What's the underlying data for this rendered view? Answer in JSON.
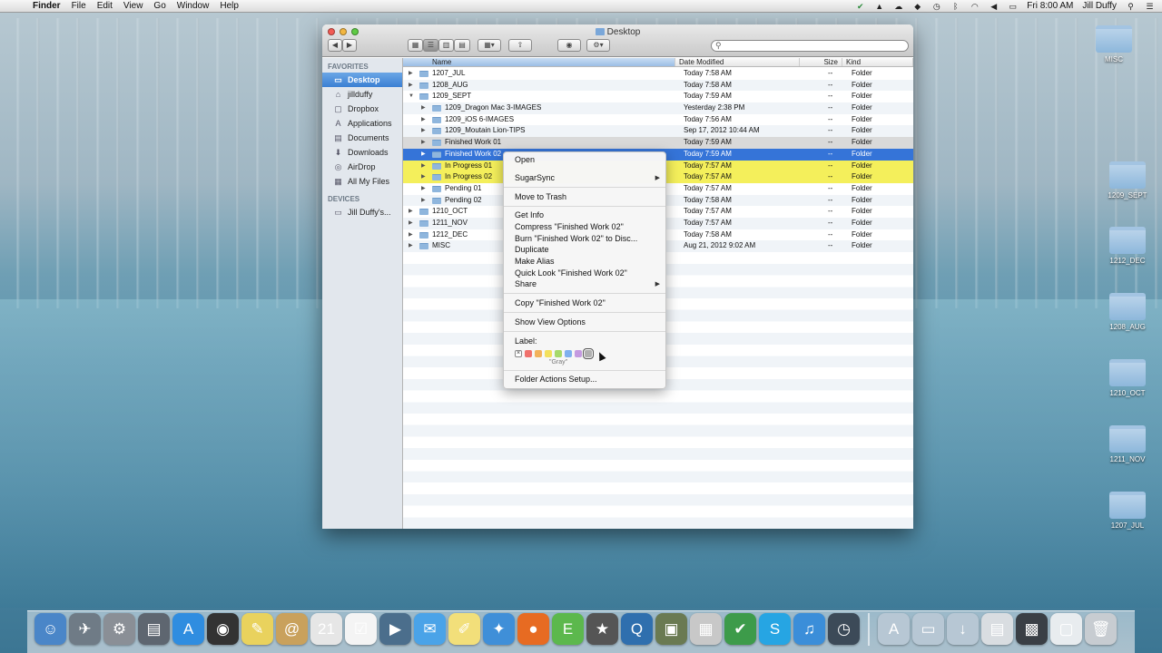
{
  "menubar": {
    "app_name": "Finder",
    "menus": [
      "File",
      "Edit",
      "View",
      "Go",
      "Window",
      "Help"
    ],
    "time": "Fri 8:00 AM",
    "user": "Jill Duffy"
  },
  "window": {
    "title": "Desktop",
    "search_placeholder": ""
  },
  "sidebar": {
    "favorites_heading": "FAVORITES",
    "favorites": [
      {
        "label": "Desktop",
        "icon": "desktop-icon"
      },
      {
        "label": "jillduffy",
        "icon": "home-icon"
      },
      {
        "label": "Dropbox",
        "icon": "dropbox-icon"
      },
      {
        "label": "Applications",
        "icon": "applications-icon"
      },
      {
        "label": "Documents",
        "icon": "documents-icon"
      },
      {
        "label": "Downloads",
        "icon": "downloads-icon"
      },
      {
        "label": "AirDrop",
        "icon": "airdrop-icon"
      },
      {
        "label": "All My Files",
        "icon": "all-files-icon"
      }
    ],
    "devices_heading": "DEVICES",
    "devices": [
      {
        "label": "Jill Duffy's...",
        "icon": "computer-icon"
      }
    ]
  },
  "columns": {
    "name": "Name",
    "date": "Date Modified",
    "size": "Size",
    "kind": "Kind"
  },
  "rows": [
    {
      "name": "1207_JUL",
      "date": "Today 7:58 AM",
      "size": "--",
      "kind": "Folder"
    },
    {
      "name": "1208_AUG",
      "date": "Today 7:58 AM",
      "size": "--",
      "kind": "Folder"
    },
    {
      "name": "1209_SEPT",
      "date": "Today 7:59 AM",
      "size": "--",
      "kind": "Folder"
    },
    {
      "name": "1209_Dragon Mac 3-IMAGES",
      "date": "Yesterday 2:38 PM",
      "size": "--",
      "kind": "Folder"
    },
    {
      "name": "1209_iOS 6-IMAGES",
      "date": "Today 7:56 AM",
      "size": "--",
      "kind": "Folder"
    },
    {
      "name": "1209_Moutain Lion-TIPS",
      "date": "Sep 17, 2012 10:44 AM",
      "size": "--",
      "kind": "Folder"
    },
    {
      "name": "Finished Work 01",
      "date": "Today 7:59 AM",
      "size": "--",
      "kind": "Folder"
    },
    {
      "name": "Finished Work 02",
      "date": "Today 7:59 AM",
      "size": "--",
      "kind": "Folder"
    },
    {
      "name": "In Progress 01",
      "date": "Today 7:57 AM",
      "size": "--",
      "kind": "Folder"
    },
    {
      "name": "In Progress 02",
      "date": "Today 7:57 AM",
      "size": "--",
      "kind": "Folder"
    },
    {
      "name": "Pending 01",
      "date": "Today 7:57 AM",
      "size": "--",
      "kind": "Folder"
    },
    {
      "name": "Pending 02",
      "date": "Today 7:58 AM",
      "size": "--",
      "kind": "Folder"
    },
    {
      "name": "1210_OCT",
      "date": "Today 7:57 AM",
      "size": "--",
      "kind": "Folder"
    },
    {
      "name": "1211_NOV",
      "date": "Today 7:57 AM",
      "size": "--",
      "kind": "Folder"
    },
    {
      "name": "1212_DEC",
      "date": "Today 7:58 AM",
      "size": "--",
      "kind": "Folder"
    },
    {
      "name": "MISC",
      "date": "Aug 21, 2012 9:02 AM",
      "size": "--",
      "kind": "Folder"
    }
  ],
  "context_menu": {
    "open": "Open",
    "sugarsync": "SugarSync",
    "move_to_trash": "Move to Trash",
    "get_info": "Get Info",
    "compress": "Compress \"Finished Work 02\"",
    "burn": "Burn \"Finished Work 02\" to Disc...",
    "duplicate": "Duplicate",
    "make_alias": "Make Alias",
    "quick_look": "Quick Look \"Finished Work 02\"",
    "share": "Share",
    "copy": "Copy \"Finished Work 02\"",
    "show_view_options": "Show View Options",
    "label_heading": "Label:",
    "label_hover": "\"Gray\"",
    "label_colors": [
      "#f0716c",
      "#f2b25b",
      "#f3e05c",
      "#a6d96a",
      "#7fb0ee",
      "#c49ae0",
      "#b0b0b0"
    ],
    "folder_actions": "Folder Actions Setup..."
  },
  "desktop_icons": [
    "MISC",
    "1209_SEPT",
    "1212_DEC",
    "1208_AUG",
    "1210_OCT",
    "1211_NOV",
    "1207_JUL"
  ],
  "dock_apps": [
    {
      "name": "finder-icon",
      "glyph": "☺",
      "color": "#4a86c8"
    },
    {
      "name": "launchpad-icon",
      "glyph": "✈",
      "color": "#6f7b86"
    },
    {
      "name": "system-preferences-icon",
      "glyph": "⚙",
      "color": "#8a8f96"
    },
    {
      "name": "app-icon-1",
      "glyph": "▤",
      "color": "#5e6670"
    },
    {
      "name": "app-store-icon",
      "glyph": "A",
      "color": "#2f8de0"
    },
    {
      "name": "dashboard-icon",
      "glyph": "◉",
      "color": "#333"
    },
    {
      "name": "stickies-icon",
      "glyph": "✎",
      "color": "#e9d25d"
    },
    {
      "name": "mail-icon",
      "glyph": "@",
      "color": "#c9a15c"
    },
    {
      "name": "calendar-icon",
      "glyph": "21",
      "color": "#e6e6e6"
    },
    {
      "name": "reminders-icon",
      "glyph": "☑",
      "color": "#f4f4f4"
    },
    {
      "name": "facetime-icon",
      "glyph": "▶",
      "color": "#4b6e8c"
    },
    {
      "name": "messages-icon",
      "glyph": "✉",
      "color": "#4aa3e8"
    },
    {
      "name": "notes-icon",
      "glyph": "✐",
      "color": "#f2df7a"
    },
    {
      "name": "safari-icon",
      "glyph": "✦",
      "color": "#3f8fd8"
    },
    {
      "name": "firefox-icon",
      "glyph": "●",
      "color": "#e76b22"
    },
    {
      "name": "evernote-icon",
      "glyph": "E",
      "color": "#5cb84d"
    },
    {
      "name": "imovie-icon",
      "glyph": "★",
      "color": "#555"
    },
    {
      "name": "quicktime-icon",
      "glyph": "Q",
      "color": "#2f6fae"
    },
    {
      "name": "preview-icon",
      "glyph": "▣",
      "color": "#6a7a52"
    },
    {
      "name": "calculator-icon",
      "glyph": "▦",
      "color": "#c8c8c8"
    },
    {
      "name": "upwork-icon",
      "glyph": "✔",
      "color": "#3d9b4a"
    },
    {
      "name": "skype-icon",
      "glyph": "S",
      "color": "#26a5e3"
    },
    {
      "name": "itunes-icon",
      "glyph": "♫",
      "color": "#3b8ed9"
    },
    {
      "name": "time-machine-icon",
      "glyph": "◷",
      "color": "#3c4a58"
    }
  ],
  "dock_stacks": [
    {
      "name": "applications-stack-icon",
      "glyph": "A",
      "color": "#b7c7d4"
    },
    {
      "name": "documents-stack-icon",
      "glyph": "▭",
      "color": "#b7c7d4"
    },
    {
      "name": "downloads-stack-icon",
      "glyph": "↓",
      "color": "#b7c7d4"
    },
    {
      "name": "stack-icon-1",
      "glyph": "▤",
      "color": "#d9dde1"
    },
    {
      "name": "stack-icon-2",
      "glyph": "▩",
      "color": "#3a3f45"
    },
    {
      "name": "stack-icon-3",
      "glyph": "▢",
      "color": "#e8ecef"
    },
    {
      "name": "trash-icon",
      "glyph": "🗑",
      "color": "#c7ccd1"
    }
  ]
}
